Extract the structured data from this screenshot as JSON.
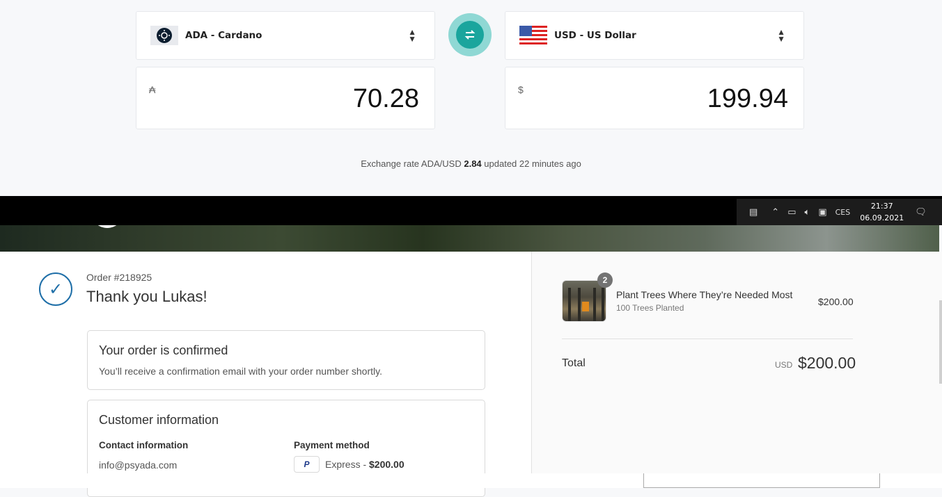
{
  "converter": {
    "from": {
      "label": "ADA - Cardano",
      "symbol": "₳",
      "amount": "70.28"
    },
    "to": {
      "label": "USD - US Dollar",
      "symbol": "$",
      "amount": "199.94"
    },
    "rate": {
      "prefix": "Exchange rate ADA/USD",
      "value": "2.84",
      "suffix": "updated 22 minutes ago"
    }
  },
  "tray": {
    "language": "CES",
    "time": "21:37",
    "date": "06.09.2021"
  },
  "order": {
    "number": "Order #218925",
    "thanks": "Thank you Lukas!",
    "confirmed_title": "Your order is confirmed",
    "confirmed_text": "You’ll receive a confirmation email with your order number shortly.",
    "customer_title": "Customer information",
    "contact_label": "Contact information",
    "contact_value": "info@psyada.com",
    "payment_label": "Payment method",
    "payment_value": "Express - ",
    "payment_amount": "$200.00"
  },
  "summary": {
    "qty": "2",
    "product_name": "Plant Trees Where They’re Needed Most",
    "product_variant": "100 Trees Planted",
    "product_price": "$200.00",
    "total_label": "Total",
    "total_currency": "USD",
    "total_value": "$200.00"
  }
}
